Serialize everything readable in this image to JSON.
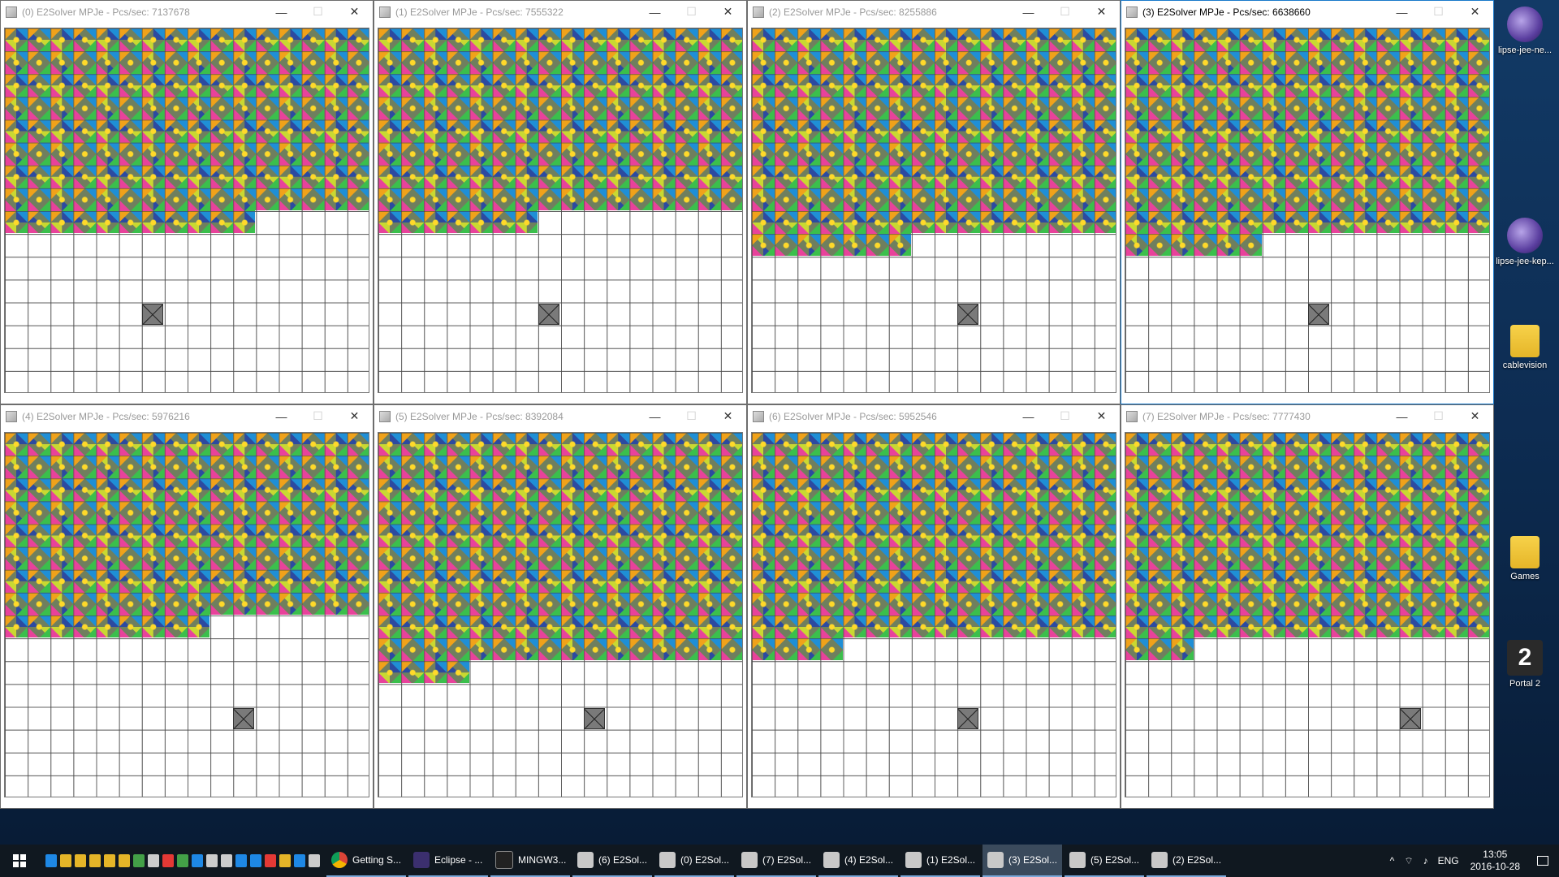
{
  "windows": [
    {
      "title": "(0) E2Solver MPJe - Pcs/sec: 7137678",
      "active": false
    },
    {
      "title": "(1) E2Solver MPJe - Pcs/sec: 7555322",
      "active": false
    },
    {
      "title": "(2) E2Solver MPJe - Pcs/sec: 8255886",
      "active": false
    },
    {
      "title": "(3) E2Solver MPJe - Pcs/sec: 6638660",
      "active": true
    },
    {
      "title": "(4) E2Solver MPJe - Pcs/sec: 5976216",
      "active": false
    },
    {
      "title": "(5) E2Solver MPJe - Pcs/sec: 8392084",
      "active": false
    },
    {
      "title": "(6) E2Solver MPJe - Pcs/sec: 5952546",
      "active": false
    },
    {
      "title": "(7) E2Solver MPJe - Pcs/sec: 7777430",
      "active": false
    }
  ],
  "window_buttons": {
    "minimize": "—",
    "maximize": "☐",
    "close": "✕"
  },
  "desktop_icons": [
    {
      "label": "lipse-jee-ne...",
      "icon": "eclipse-icon"
    },
    {
      "label": "lipse-jee-kep...",
      "icon": "eclipse-icon"
    },
    {
      "label": "cablevision",
      "icon": "folder-icon"
    },
    {
      "label": "Games",
      "icon": "folder-icon"
    },
    {
      "label": "Portal 2",
      "icon": "portal2-icon"
    }
  ],
  "taskbar": {
    "tasks": [
      {
        "label": "Getting S...",
        "icon": "chrome-icon"
      },
      {
        "label": "Eclipse - ...",
        "icon": "eclipse-icon"
      },
      {
        "label": "MINGW3...",
        "icon": "terminal-icon"
      },
      {
        "label": "(6) E2Sol...",
        "icon": "java-icon"
      },
      {
        "label": "(0) E2Sol...",
        "icon": "java-icon"
      },
      {
        "label": "(7) E2Sol...",
        "icon": "java-icon"
      },
      {
        "label": "(4) E2Sol...",
        "icon": "java-icon"
      },
      {
        "label": "(1) E2Sol...",
        "icon": "java-icon"
      },
      {
        "label": "(3) E2Sol...",
        "icon": "java-icon"
      },
      {
        "label": "(5) E2Sol...",
        "icon": "java-icon"
      },
      {
        "label": "(2) E2Sol...",
        "icon": "java-icon"
      }
    ],
    "active_task": "(3) E2Sol...",
    "language": "ENG",
    "time": "13:05",
    "date": "2016-10-28"
  }
}
